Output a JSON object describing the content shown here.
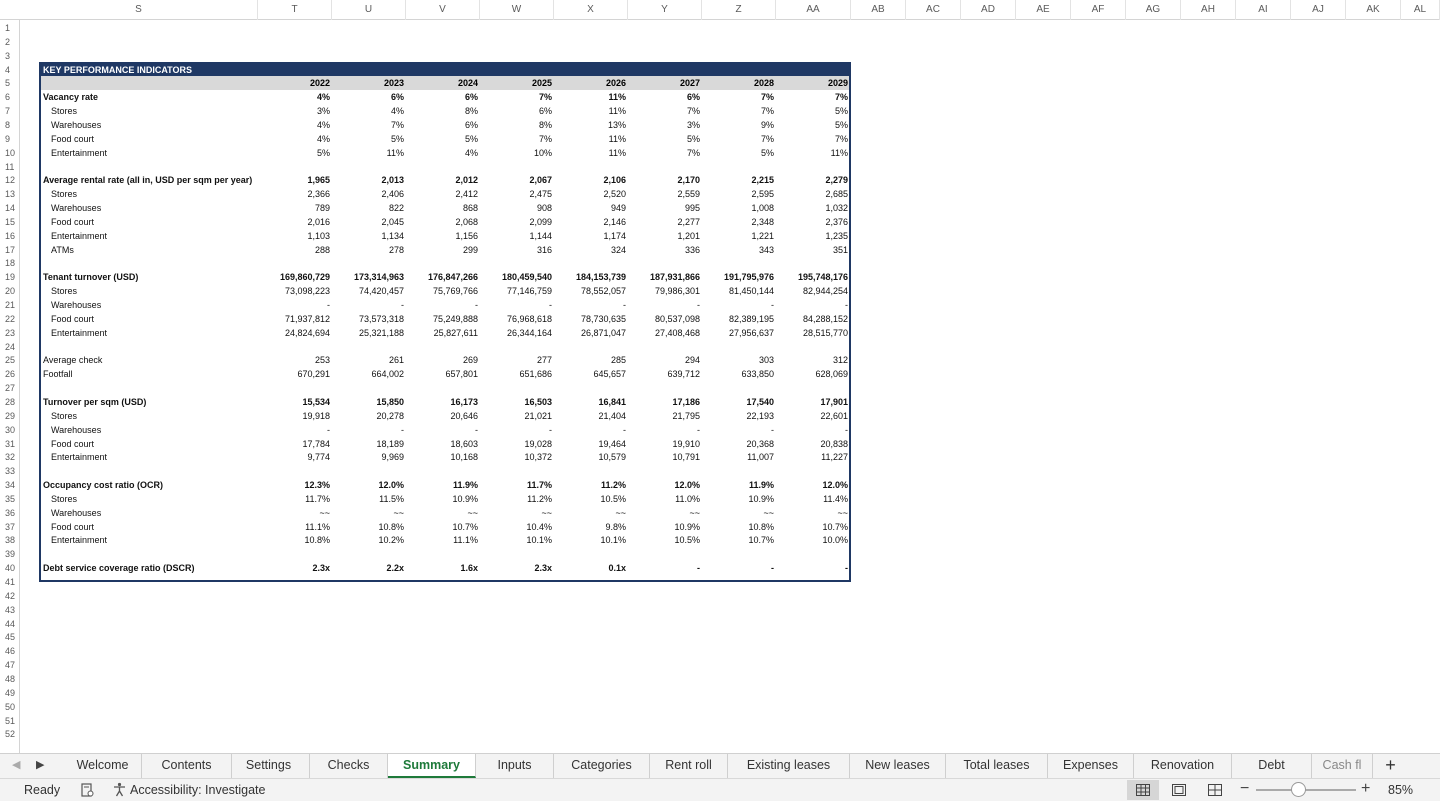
{
  "columns": [
    "S",
    "T",
    "U",
    "V",
    "W",
    "X",
    "Y",
    "Z",
    "AA",
    "AB",
    "AC",
    "AD",
    "AE",
    "AF",
    "AG",
    "AH",
    "AI",
    "AJ",
    "AK",
    "AL"
  ],
  "rows": [
    "1",
    "2",
    "3",
    "4",
    "5",
    "6",
    "7",
    "8",
    "9",
    "10",
    "11",
    "12",
    "13",
    "14",
    "15",
    "16",
    "17",
    "18",
    "19",
    "20",
    "21",
    "22",
    "23",
    "24",
    "25",
    "26",
    "27",
    "28",
    "29",
    "30",
    "31",
    "32",
    "33",
    "34",
    "35",
    "36",
    "37",
    "38",
    "39",
    "40",
    "41",
    "42",
    "43",
    "44",
    "45",
    "46",
    "47",
    "48",
    "49",
    "50",
    "51",
    "52"
  ],
  "kpi": {
    "title": "KEY PERFORMANCE INDICATORS",
    "years": [
      "2022",
      "2023",
      "2024",
      "2025",
      "2026",
      "2027",
      "2028",
      "2029"
    ],
    "rows": [
      {
        "row": 6,
        "label": "Vacancy rate",
        "bold": true,
        "values": [
          "4%",
          "6%",
          "6%",
          "7%",
          "11%",
          "6%",
          "7%",
          "7%"
        ]
      },
      {
        "row": 7,
        "label": "Stores",
        "values": [
          "3%",
          "4%",
          "8%",
          "6%",
          "11%",
          "7%",
          "7%",
          "5%"
        ]
      },
      {
        "row": 8,
        "label": "Warehouses",
        "values": [
          "4%",
          "7%",
          "6%",
          "8%",
          "13%",
          "3%",
          "9%",
          "5%"
        ]
      },
      {
        "row": 9,
        "label": "Food court",
        "values": [
          "4%",
          "5%",
          "5%",
          "7%",
          "11%",
          "5%",
          "7%",
          "7%"
        ]
      },
      {
        "row": 10,
        "label": "Entertainment",
        "values": [
          "5%",
          "11%",
          "4%",
          "10%",
          "11%",
          "7%",
          "5%",
          "11%"
        ]
      },
      {
        "row": 12,
        "label": "Average rental rate (all in, USD per sqm per year)",
        "bold": true,
        "values": [
          "1,965",
          "2,013",
          "2,012",
          "2,067",
          "2,106",
          "2,170",
          "2,215",
          "2,279"
        ]
      },
      {
        "row": 13,
        "label": "Stores",
        "values": [
          "2,366",
          "2,406",
          "2,412",
          "2,475",
          "2,520",
          "2,559",
          "2,595",
          "2,685"
        ]
      },
      {
        "row": 14,
        "label": "Warehouses",
        "values": [
          "789",
          "822",
          "868",
          "908",
          "949",
          "995",
          "1,008",
          "1,032"
        ]
      },
      {
        "row": 15,
        "label": "Food court",
        "values": [
          "2,016",
          "2,045",
          "2,068",
          "2,099",
          "2,146",
          "2,277",
          "2,348",
          "2,376"
        ]
      },
      {
        "row": 16,
        "label": "Entertainment",
        "values": [
          "1,103",
          "1,134",
          "1,156",
          "1,144",
          "1,174",
          "1,201",
          "1,221",
          "1,235"
        ]
      },
      {
        "row": 17,
        "label": "ATMs",
        "values": [
          "288",
          "278",
          "299",
          "316",
          "324",
          "336",
          "343",
          "351"
        ]
      },
      {
        "row": 19,
        "label": "Tenant turnover (USD)",
        "bold": true,
        "values": [
          "169,860,729",
          "173,314,963",
          "176,847,266",
          "180,459,540",
          "184,153,739",
          "187,931,866",
          "191,795,976",
          "195,748,176"
        ]
      },
      {
        "row": 20,
        "label": "Stores",
        "values": [
          "73,098,223",
          "74,420,457",
          "75,769,766",
          "77,146,759",
          "78,552,057",
          "79,986,301",
          "81,450,144",
          "82,944,254"
        ]
      },
      {
        "row": 21,
        "label": "Warehouses",
        "values": [
          "-",
          "-",
          "-",
          "-",
          "-",
          "-",
          "-",
          "-"
        ]
      },
      {
        "row": 22,
        "label": "Food court",
        "values": [
          "71,937,812",
          "73,573,318",
          "75,249,888",
          "76,968,618",
          "78,730,635",
          "80,537,098",
          "82,389,195",
          "84,288,152"
        ]
      },
      {
        "row": 23,
        "label": "Entertainment",
        "values": [
          "24,824,694",
          "25,321,188",
          "25,827,611",
          "26,344,164",
          "26,871,047",
          "27,408,468",
          "27,956,637",
          "28,515,770"
        ]
      },
      {
        "row": 25,
        "label": "Average check",
        "top": true,
        "values": [
          "253",
          "261",
          "269",
          "277",
          "285",
          "294",
          "303",
          "312"
        ]
      },
      {
        "row": 26,
        "label": "Footfall",
        "top": true,
        "values": [
          "670,291",
          "664,002",
          "657,801",
          "651,686",
          "645,657",
          "639,712",
          "633,850",
          "628,069"
        ]
      },
      {
        "row": 28,
        "label": "Turnover per sqm (USD)",
        "bold": true,
        "values": [
          "15,534",
          "15,850",
          "16,173",
          "16,503",
          "16,841",
          "17,186",
          "17,540",
          "17,901"
        ]
      },
      {
        "row": 29,
        "label": "Stores",
        "values": [
          "19,918",
          "20,278",
          "20,646",
          "21,021",
          "21,404",
          "21,795",
          "22,193",
          "22,601"
        ]
      },
      {
        "row": 30,
        "label": "Warehouses",
        "values": [
          "-",
          "-",
          "-",
          "-",
          "-",
          "-",
          "-",
          "-"
        ]
      },
      {
        "row": 31,
        "label": "Food court",
        "values": [
          "17,784",
          "18,189",
          "18,603",
          "19,028",
          "19,464",
          "19,910",
          "20,368",
          "20,838"
        ]
      },
      {
        "row": 32,
        "label": "Entertainment",
        "values": [
          "9,774",
          "9,969",
          "10,168",
          "10,372",
          "10,579",
          "10,791",
          "11,007",
          "11,227"
        ]
      },
      {
        "row": 34,
        "label": "Occupancy cost ratio (OCR)",
        "bold": true,
        "values": [
          "12.3%",
          "12.0%",
          "11.9%",
          "11.7%",
          "11.2%",
          "12.0%",
          "11.9%",
          "12.0%"
        ]
      },
      {
        "row": 35,
        "label": "Stores",
        "values": [
          "11.7%",
          "11.5%",
          "10.9%",
          "11.2%",
          "10.5%",
          "11.0%",
          "10.9%",
          "11.4%"
        ]
      },
      {
        "row": 36,
        "label": "Warehouses",
        "values": [
          "~~",
          "~~",
          "~~",
          "~~",
          "~~",
          "~~",
          "~~",
          "~~"
        ]
      },
      {
        "row": 37,
        "label": "Food court",
        "values": [
          "11.1%",
          "10.8%",
          "10.7%",
          "10.4%",
          "9.8%",
          "10.9%",
          "10.8%",
          "10.7%"
        ]
      },
      {
        "row": 38,
        "label": "Entertainment",
        "values": [
          "10.8%",
          "10.2%",
          "11.1%",
          "10.1%",
          "10.1%",
          "10.5%",
          "10.7%",
          "10.0%"
        ]
      },
      {
        "row": 40,
        "label": "Debt service coverage ratio (DSCR)",
        "bold": true,
        "values": [
          "2.3x",
          "2.2x",
          "1.6x",
          "2.3x",
          "0.1x",
          "-",
          "-",
          "-"
        ]
      }
    ]
  },
  "tabs": [
    "Welcome",
    "Contents",
    "Settings",
    "Checks",
    "Summary",
    "Inputs",
    "Categories",
    "Rent roll",
    "Existing leases",
    "New leases",
    "Total leases",
    "Expenses",
    "Renovation",
    "Debt",
    "Cash fl"
  ],
  "active_tab": "Summary",
  "status": {
    "ready": "Ready",
    "accessibility": "Accessibility: Investigate",
    "zoom": "85%"
  },
  "icons": {
    "prev": "triangle-left-icon",
    "next": "triangle-right-icon",
    "add": "plus-icon",
    "macro": "macro-recording-icon",
    "accessibility": "accessibility-icon",
    "normal_view": "grid-view-icon",
    "page_layout": "page-layout-icon",
    "page_break": "page-break-preview-icon"
  },
  "colors": {
    "kpi_header": "#1f3864",
    "year_band": "#d9d9d9",
    "active_tab": "#1e7a3a"
  }
}
